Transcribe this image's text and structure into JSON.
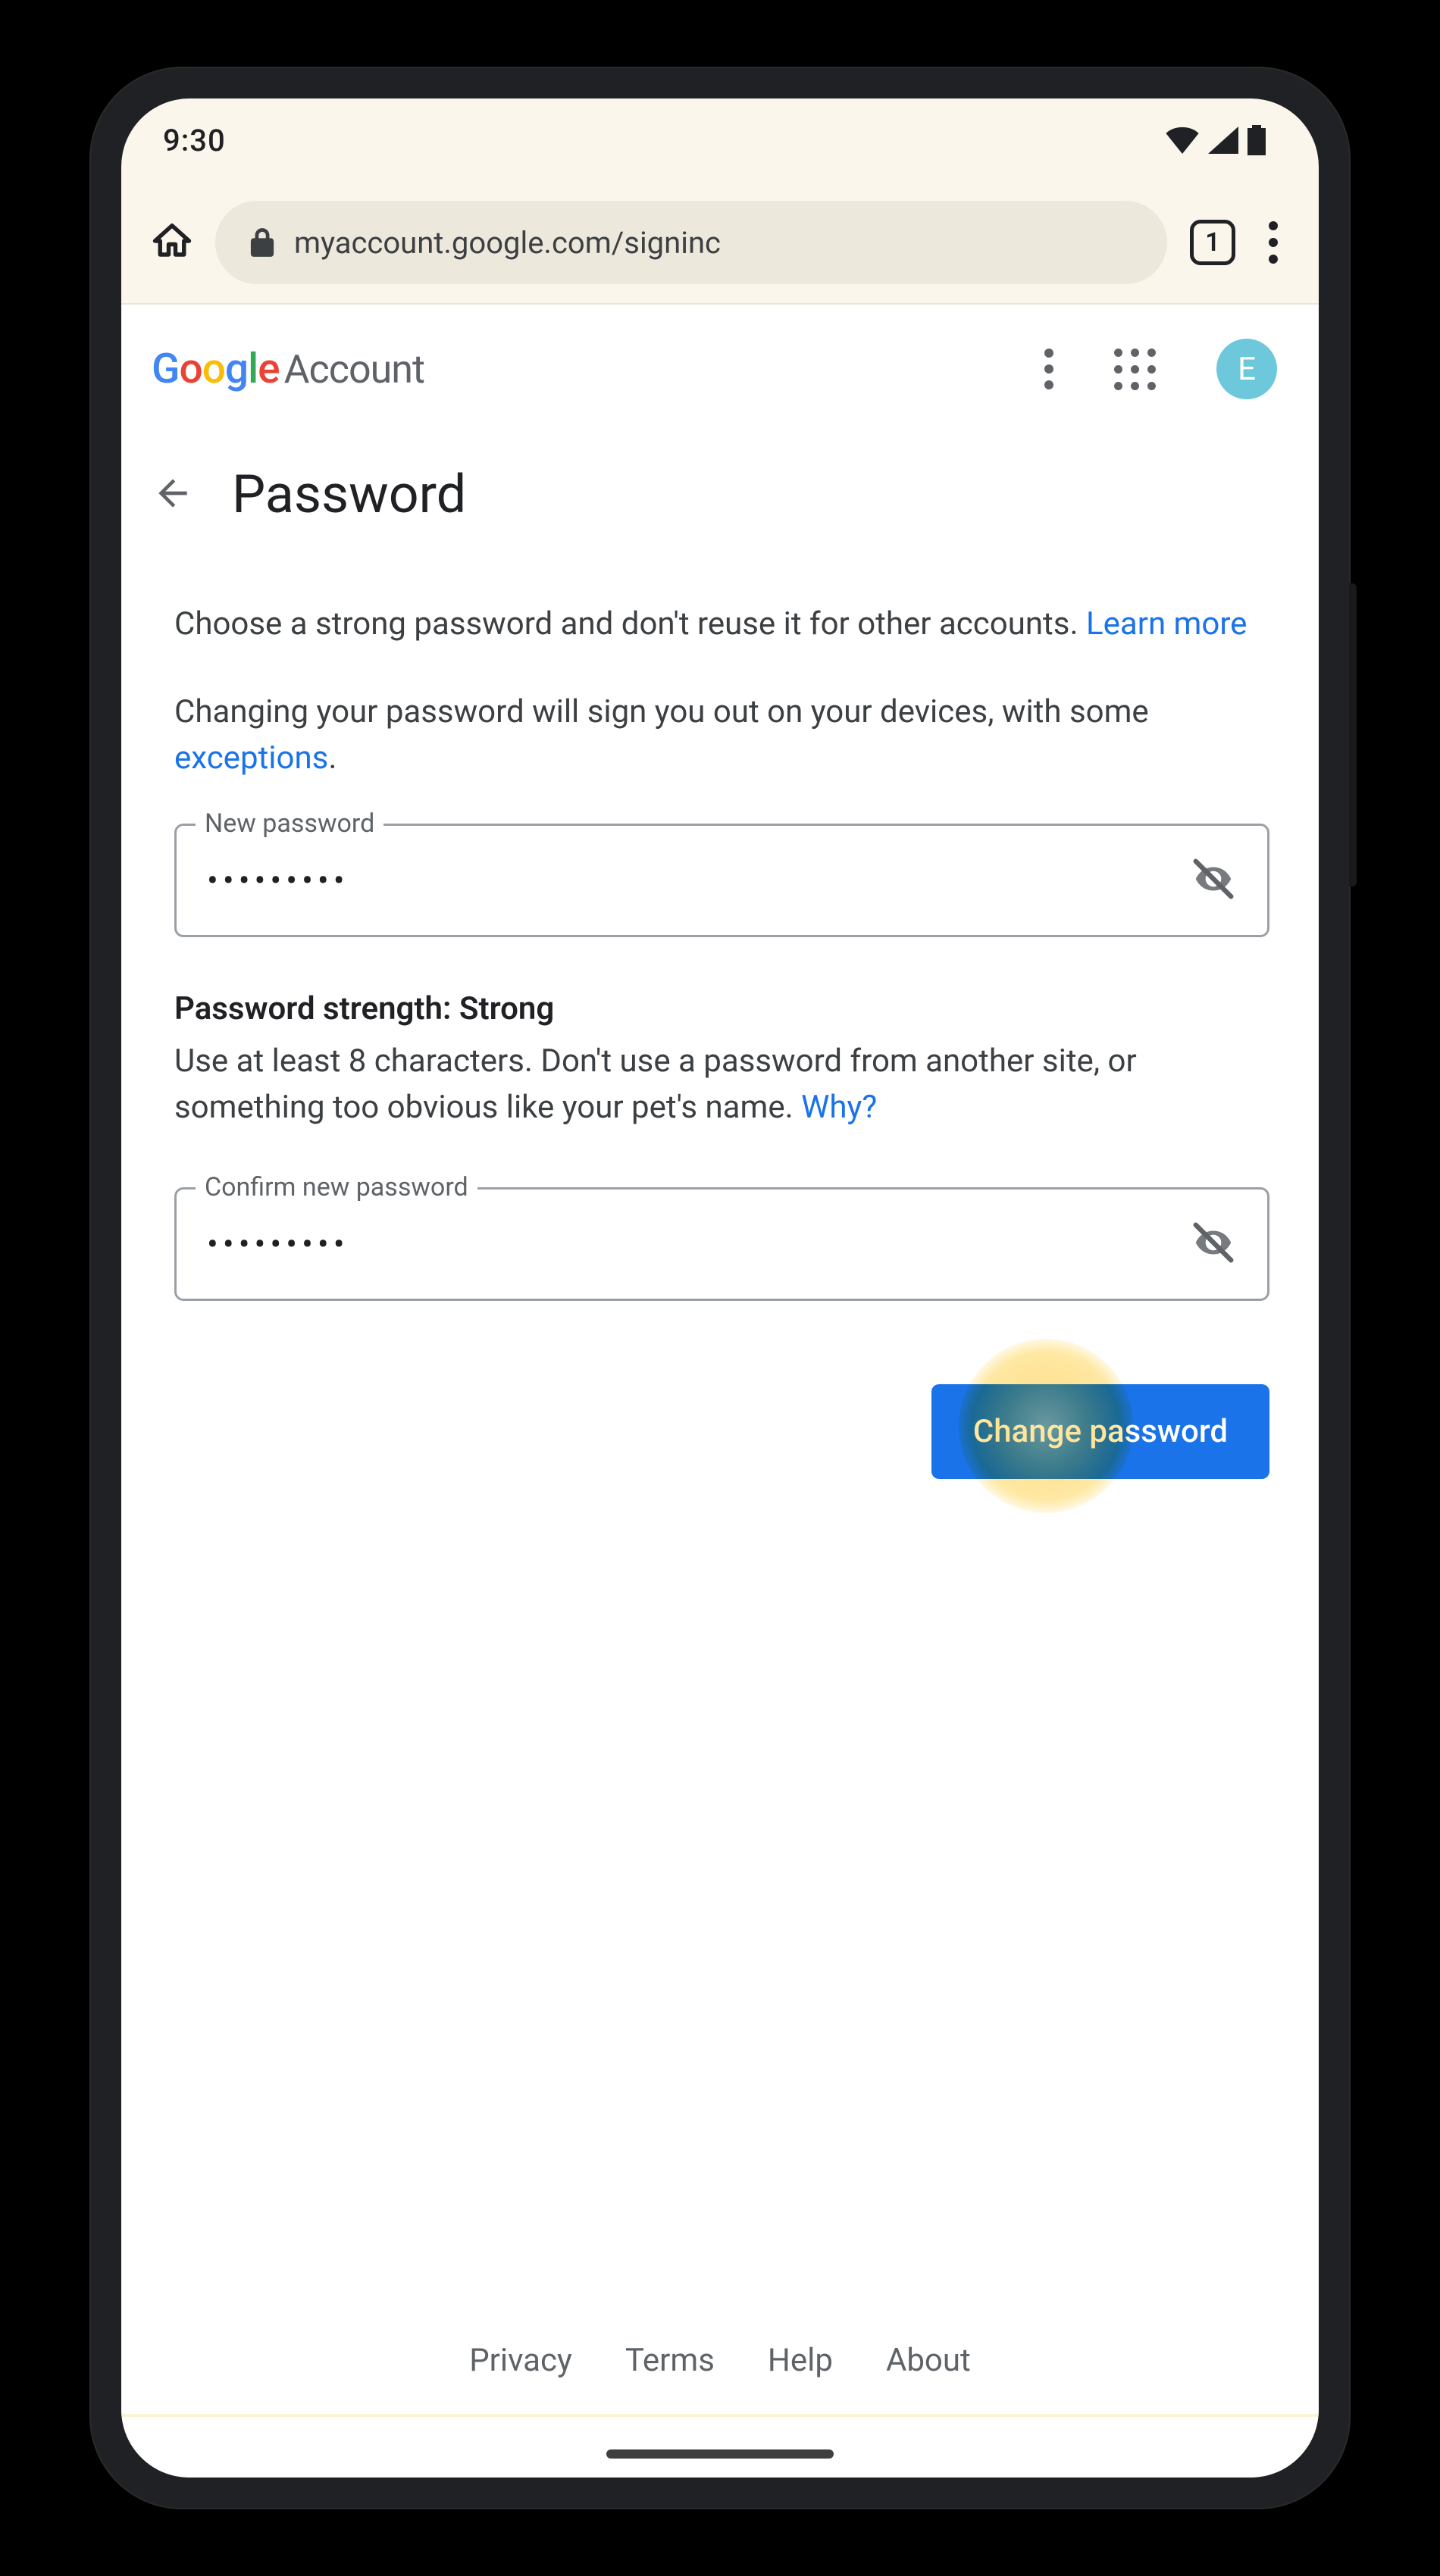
{
  "status_bar": {
    "time": "9:30"
  },
  "browser": {
    "url": "myaccount.google.com/signinc",
    "tab_count": "1"
  },
  "header": {
    "logo_letters": {
      "g1": "G",
      "o1": "o",
      "o2": "o",
      "g2": "g",
      "l": "l",
      "e": "e"
    },
    "account_label": "Account",
    "avatar_initial": "E"
  },
  "page": {
    "title": "Password",
    "desc1_a": "Choose a strong password and don't reuse it for other accounts. ",
    "desc1_link": "Learn more",
    "desc2_a": "Changing your password will sign you out on your devices, with some ",
    "desc2_link": "exceptions",
    "desc2_b": "."
  },
  "fields": {
    "new_password": {
      "label": "New password",
      "value": "•••••••••"
    },
    "confirm_password": {
      "label": "Confirm new password",
      "value": "•••••••••"
    }
  },
  "strength": {
    "title": "Password strength: Strong",
    "help_a": "Use at least 8 characters. Don't use a password from another site, or something too obvious like your pet's name. ",
    "help_link": "Why?"
  },
  "actions": {
    "change_password": "Change password"
  },
  "footer": {
    "privacy": "Privacy",
    "terms": "Terms",
    "help": "Help",
    "about": "About"
  }
}
